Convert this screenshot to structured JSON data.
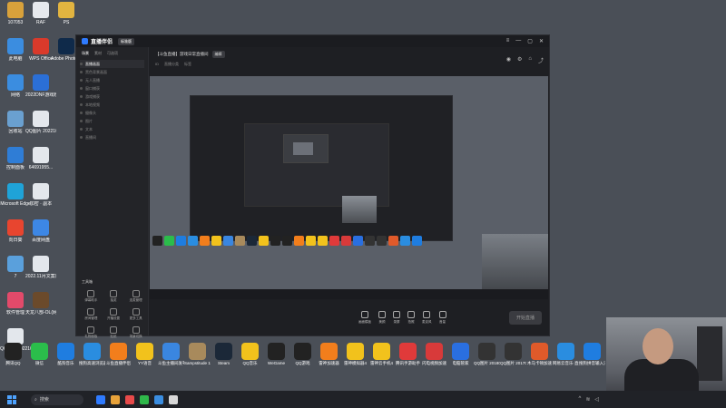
{
  "desktop": {
    "left_col1": [
      {
        "label": "107053",
        "color": "#d8a13b",
        "icon": "folder-icon"
      },
      {
        "label": "此电脑",
        "color": "#3b8de0",
        "icon": "computer-icon"
      },
      {
        "label": "网络",
        "color": "#3b8de0",
        "icon": "network-icon"
      },
      {
        "label": "回收站",
        "color": "#6aa0d0",
        "icon": "recycle-bin-icon"
      },
      {
        "label": "控制面板",
        "color": "#2f7dd6",
        "icon": "control-panel-icon"
      },
      {
        "label": "Microsoft Edge",
        "color": "#1fa3d8",
        "icon": "edge-icon"
      },
      {
        "label": "向日葵",
        "color": "#e8452f",
        "icon": "sunflower-icon"
      },
      {
        "label": "7",
        "color": "#5aa0dc",
        "icon": "app-icon"
      },
      {
        "label": "软件管理",
        "color": "#e24a6a",
        "icon": "software-manager-icon"
      },
      {
        "label": "QQ图片 2022102...",
        "color": "#e3e7ec",
        "icon": "image-file-icon"
      }
    ],
    "left_col2": [
      {
        "label": "RAF",
        "color": "#e6e9ee",
        "icon": "file-icon"
      },
      {
        "label": "WPS Office",
        "color": "#d93a2b",
        "icon": "wps-icon"
      },
      {
        "label": "2022DNF游戏粉丝福...",
        "color": "#2b6fd6",
        "icon": "word-doc-icon"
      },
      {
        "label": "QQ图片 2022103...",
        "color": "#e3e7ec",
        "icon": "image-file-icon"
      },
      {
        "label": "64691955...",
        "color": "#e3e7ec",
        "icon": "file-icon"
      },
      {
        "label": "加密 · 副本",
        "color": "#e3e7ec",
        "icon": "file-icon"
      },
      {
        "label": "百度网盘",
        "color": "#3d87e5",
        "icon": "baidu-netdisk-icon"
      },
      {
        "label": "2022.11月文案日常案人...",
        "color": "#e3e7ec",
        "icon": "doc-file-icon"
      },
      {
        "label": "天龙八部-OL(网)",
        "color": "#6b4a2b",
        "icon": "game-icon"
      }
    ],
    "left_col3": [
      {
        "label": "PS",
        "color": "#e2b440",
        "icon": "folder-icon"
      },
      {
        "label": "Adobe Photosh...",
        "color": "#0f2a4a",
        "icon": "photoshop-icon"
      }
    ],
    "bottom_row": [
      {
        "label": "腾讯QQ",
        "color": "#222",
        "icon": "qq-icon"
      },
      {
        "label": "微信",
        "color": "#2bbd4b",
        "icon": "wechat-icon"
      },
      {
        "label": "酷狗音乐",
        "color": "#1f7de0",
        "icon": "kugou-icon"
      },
      {
        "label": "搜狗高速浏览器",
        "color": "#2a8de0",
        "icon": "sogou-browser-icon"
      },
      {
        "label": "斗鱼直播伴侣",
        "color": "#f27e1c",
        "icon": "douyu-icon"
      },
      {
        "label": "YY语音",
        "color": "#f2c21c",
        "icon": "yy-icon"
      },
      {
        "label": "斗鱼主播间发布助理",
        "color": "#3a86e0",
        "icon": "doc-icon"
      },
      {
        "label": "Sampstitude 11",
        "color": "#a88a5c",
        "icon": "sampstitude-icon"
      },
      {
        "label": "Steam",
        "color": "#1b2838",
        "icon": "steam-icon"
      },
      {
        "label": "QQ音乐",
        "color": "#f2c21c",
        "icon": "qq-music-icon"
      },
      {
        "label": "WeGame",
        "color": "#222",
        "icon": "wegame-icon"
      },
      {
        "label": "QQ游戏",
        "color": "#222",
        "icon": "qq-game-icon"
      },
      {
        "label": "雷神加速器",
        "color": "#f27e1c",
        "icon": "leishen-icon"
      },
      {
        "label": "雷神模拟器4",
        "color": "#f2c21c",
        "icon": "leishen-emu-icon"
      },
      {
        "label": "雷神云手机4",
        "color": "#f2c21c",
        "icon": "leishen-cloud-icon"
      },
      {
        "label": "腾讯手游助手",
        "color": "#e03a3a",
        "icon": "tencent-mobile-icon"
      },
      {
        "label": "闪电视频加速",
        "color": "#d83a3a",
        "icon": "flash-icon"
      },
      {
        "label": "电脑管家",
        "color": "#2a6fe0",
        "icon": "pc-manager-icon"
      },
      {
        "label": "QQ图片 20180531...",
        "color": "#333",
        "icon": "image-file-icon"
      },
      {
        "label": "QQ图片 20170506...",
        "color": "#333",
        "icon": "image-file-icon"
      },
      {
        "label": "木马卡顿加速",
        "color": "#e05a2a",
        "icon": "accelerate-icon"
      },
      {
        "label": "网易云音乐·直播",
        "color": "#2a8de0",
        "icon": "music-icon"
      },
      {
        "label": "搜狗拼音输入法",
        "color": "#1f7de0",
        "icon": "sogou-pinyin-icon"
      }
    ]
  },
  "app": {
    "title": "直播伴侣",
    "version": "标准版",
    "left_tabs": [
      "场景",
      "素材",
      "可选项"
    ],
    "scenes": [
      "直播画面",
      "黑色背景画面",
      "无人直播",
      "窗口捕获",
      "游戏捕获",
      "本地视频",
      "摄像头",
      "图片",
      "文本",
      "直播间"
    ],
    "tools_title": "工具箱",
    "tools": [
      "弹幕助手",
      "抽奖",
      "连麦管理",
      "房间管理",
      "开播设置",
      "更多工具",
      "礼物面板",
      "贴纸",
      "场景切换"
    ],
    "room_title": "【斗鱼直播】游戏日常直播间",
    "room_tag": "编辑",
    "room_meta": [
      "ID",
      "直播分类",
      "标签"
    ],
    "bottom_buttons": [
      "画面模板",
      "美颜",
      "录屏",
      "拍照",
      "麦克风",
      "音量"
    ],
    "live_button": "开始直播"
  },
  "taskbar": {
    "search_placeholder": "搜索"
  }
}
